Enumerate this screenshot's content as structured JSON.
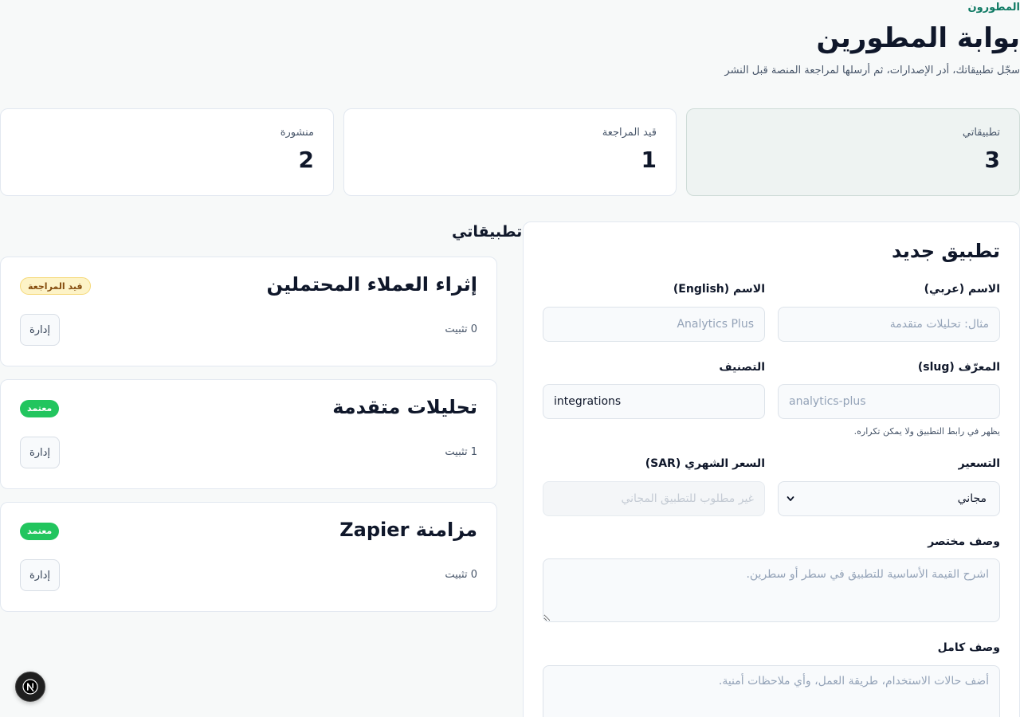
{
  "header": {
    "eyebrow": "المطورون",
    "title": "بوابة المطورين",
    "subtitle": "سجّل تطبيقاتك، أدر الإصدارات، ثم أرسلها لمراجعة المنصة قبل النشر"
  },
  "stats": [
    {
      "label": "تطبيقاتي",
      "value": "3"
    },
    {
      "label": "قيد المراجعة",
      "value": "1"
    },
    {
      "label": "منشورة",
      "value": "2"
    }
  ],
  "form": {
    "title": "تطبيق جديد",
    "name_ar": {
      "label": "الاسم (عربي)",
      "placeholder": "مثال: تحليلات متقدمة",
      "value": ""
    },
    "name_en": {
      "label": "الاسم (English)",
      "placeholder": "Analytics Plus",
      "value": ""
    },
    "slug": {
      "label": "المعرّف (slug)",
      "placeholder": "analytics-plus",
      "value": "",
      "hint": "يظهر في رابط التطبيق ولا يمكن تكراره."
    },
    "category": {
      "label": "التصنيف",
      "value": "integrations"
    },
    "pricing": {
      "label": "التسعير",
      "selected": "مجاني"
    },
    "monthly_price": {
      "label": "السعر الشهري (SAR)",
      "placeholder": "غير مطلوب للتطبيق المجاني"
    },
    "short_desc": {
      "label": "وصف مختصر",
      "placeholder": "اشرح القيمة الأساسية للتطبيق في سطر أو سطرين."
    },
    "full_desc": {
      "label": "وصف كامل",
      "placeholder": "أضف حالات الاستخدام، طريقة العمل، وأي ملاحظات أمنية."
    }
  },
  "apps_section": {
    "title": "تطبيقاتي",
    "apps": [
      {
        "name": "إثراء العملاء المحتملين",
        "status": "قيد المراجعة",
        "installs": "0 تثبيت",
        "manage": "إدارة"
      },
      {
        "name": "تحليلات متقدمة",
        "status": "معتمد",
        "installs": "1 تثبيت",
        "manage": "إدارة"
      },
      {
        "name": "مزامنة Zapier",
        "status": "معتمد",
        "installs": "0 تثبيت",
        "manage": "إدارة"
      }
    ]
  },
  "colors": {
    "accent": "#0f7a64",
    "approved": "#22c55e",
    "review_bg": "#fdf3c7",
    "review_text": "#854d0e"
  },
  "dev_indicator": {
    "letter": "N",
    "icon": "nextjs-logo-icon"
  }
}
